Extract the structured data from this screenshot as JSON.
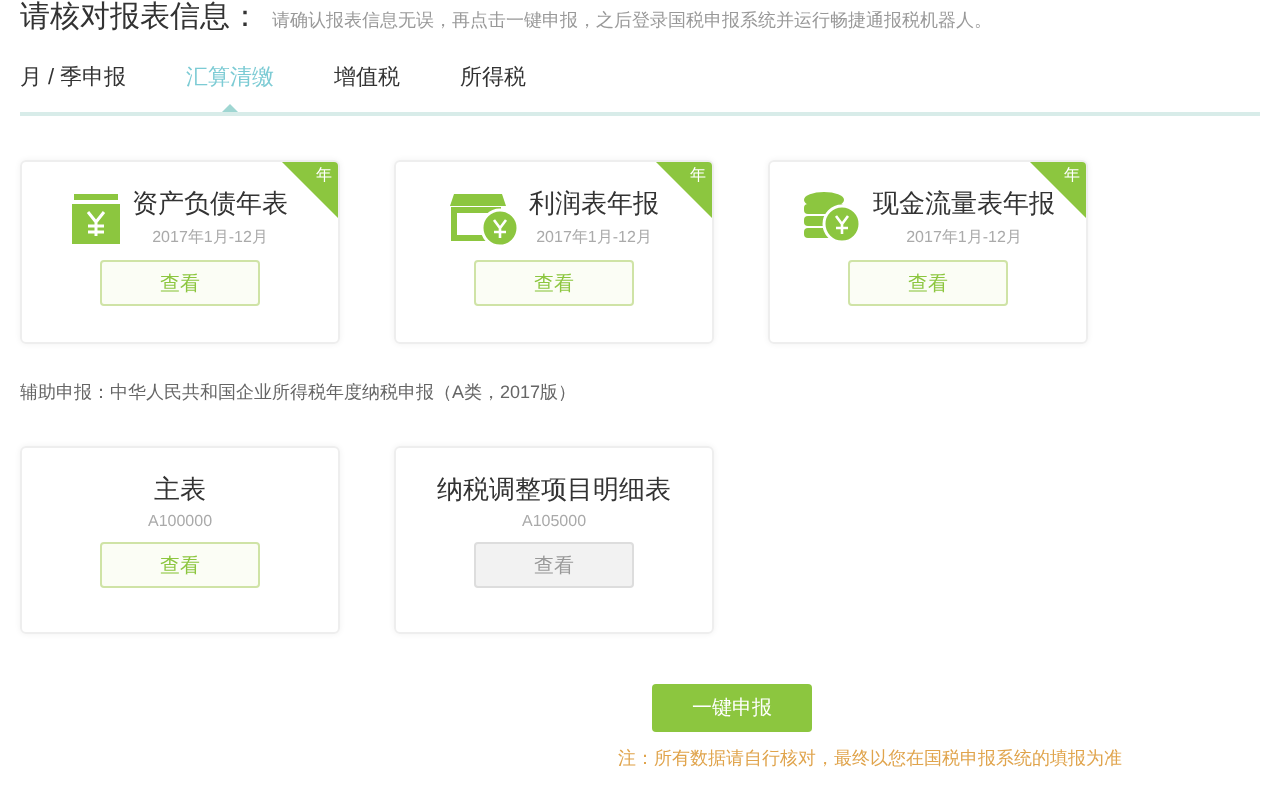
{
  "header": {
    "title": "请核对报表信息：",
    "hint": "请确认报表信息无误，再点击一键申报，之后登录国税申报系统并运行畅捷通报税机器人。"
  },
  "tabs": [
    {
      "label": "月 / 季申报",
      "selected": false
    },
    {
      "label": "汇算清缴",
      "selected": true
    },
    {
      "label": "增值税",
      "selected": false
    },
    {
      "label": "所得税",
      "selected": false
    }
  ],
  "annual_reports": [
    {
      "title": "资产负债年表",
      "period": "2017年1月-12月",
      "corner": "年",
      "button": {
        "label": "查看",
        "disabled": false
      }
    },
    {
      "title": "利润表年报",
      "period": "2017年1月-12月",
      "corner": "年",
      "button": {
        "label": "查看",
        "disabled": false
      }
    },
    {
      "title": "现金流量表年报",
      "period": "2017年1月-12月",
      "corner": "年",
      "button": {
        "label": "查看",
        "disabled": false
      }
    }
  ],
  "auxiliary_label": "辅助申报：中华人民共和国企业所得税年度纳税申报（A类，2017版）",
  "auxiliary_reports": [
    {
      "title": "主表",
      "code": "A100000",
      "button": {
        "label": "查看",
        "disabled": false
      }
    },
    {
      "title": "纳税调整项目明细表",
      "code": "A105000",
      "button": {
        "label": "查看",
        "disabled": true
      }
    }
  ],
  "submit_button": "一键申报",
  "note": "注：所有数据请自行核对，最终以您在国税申报系统的填报为准"
}
